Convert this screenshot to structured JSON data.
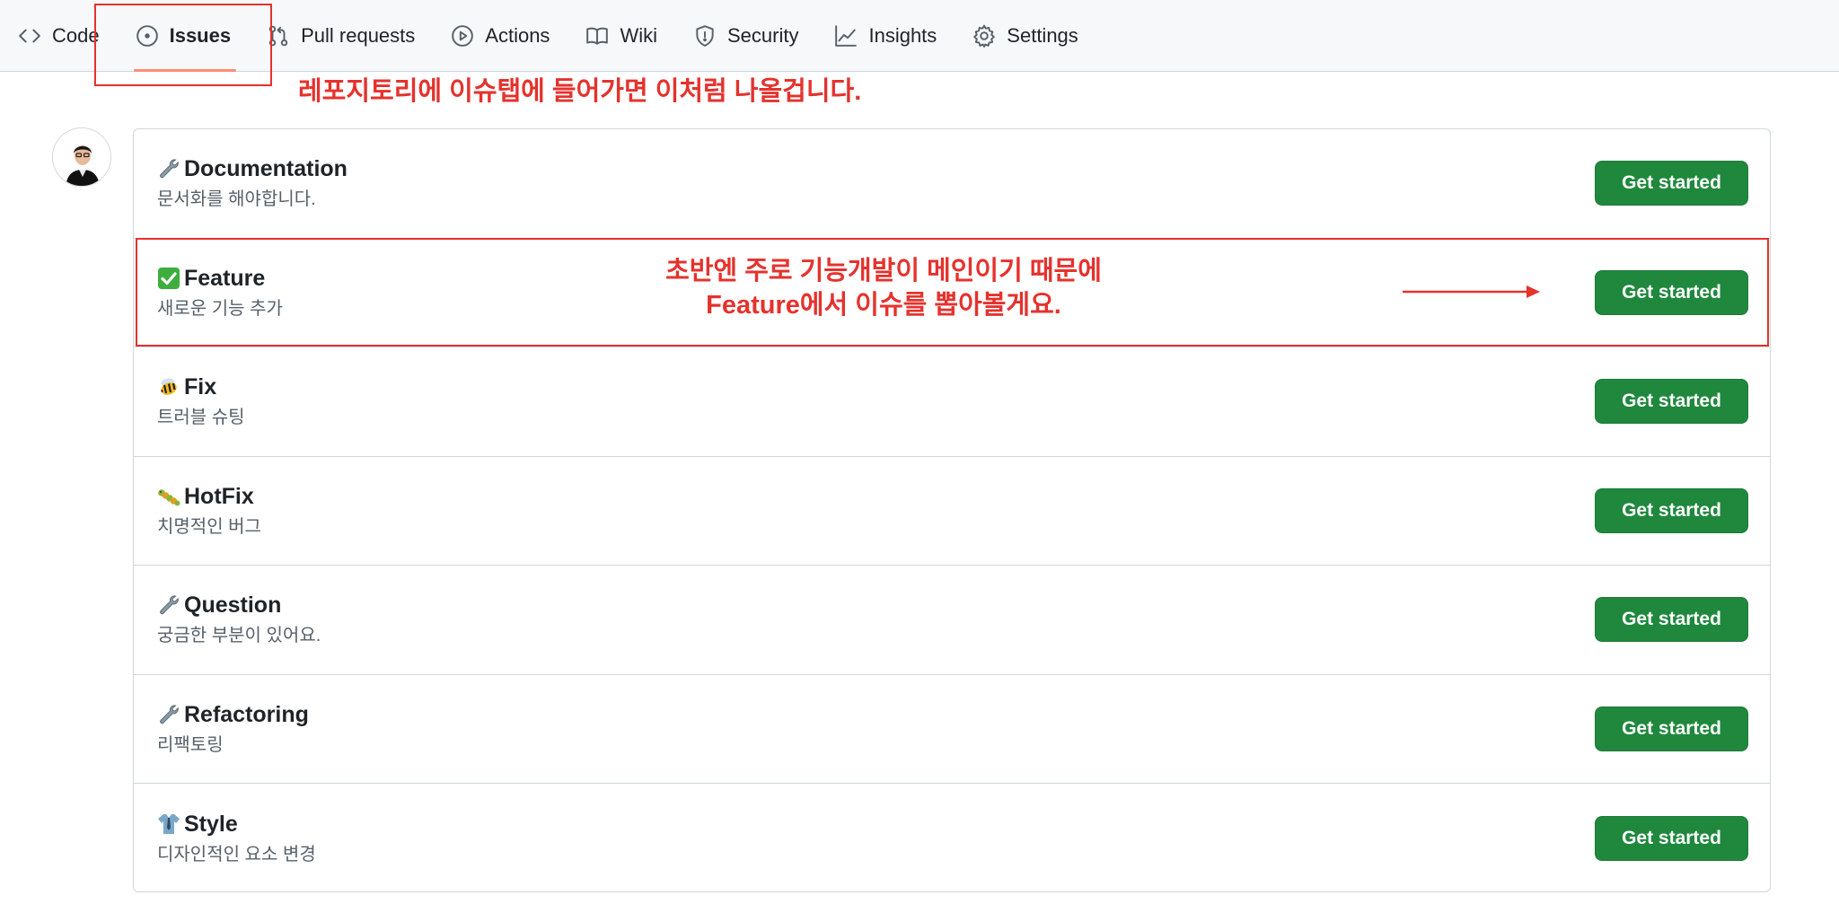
{
  "nav": {
    "items": [
      {
        "label": "Code",
        "icon": "code-icon"
      },
      {
        "label": "Issues",
        "icon": "issue-opened-icon",
        "selected": true
      },
      {
        "label": "Pull requests",
        "icon": "git-pull-request-icon"
      },
      {
        "label": "Actions",
        "icon": "play-icon"
      },
      {
        "label": "Wiki",
        "icon": "book-icon"
      },
      {
        "label": "Security",
        "icon": "shield-icon"
      },
      {
        "label": "Insights",
        "icon": "graph-icon"
      },
      {
        "label": "Settings",
        "icon": "gear-icon"
      }
    ]
  },
  "annotations": {
    "tab_note": "레포지토리에 이슈탭에 들어가면 이처럼 나올겁니다.",
    "feature_note_line1": "초반엔 주로 기능개발이 메인이기 때문에",
    "feature_note_line2": "Feature에서 이슈를 뽑아볼게요.",
    "color": "#e5322d"
  },
  "templates": [
    {
      "title": "Documentation",
      "description": "문서화를 해야합니다.",
      "emoji": "wrench-icon",
      "button": "Get started"
    },
    {
      "title": "Feature",
      "description": "새로운 기능 추가",
      "emoji": "check-mark-icon",
      "button": "Get started"
    },
    {
      "title": "Fix",
      "description": "트러블 슈팅",
      "emoji": "bee-icon",
      "button": "Get started"
    },
    {
      "title": "HotFix",
      "description": "치명적인 버그",
      "emoji": "caterpillar-icon",
      "button": "Get started"
    },
    {
      "title": "Question",
      "description": "궁금한 부분이 있어요.",
      "emoji": "wrench-icon",
      "button": "Get started"
    },
    {
      "title": "Refactoring",
      "description": "리팩토링",
      "emoji": "wrench-icon",
      "button": "Get started"
    },
    {
      "title": "Style",
      "description": "디자인적인 요소 변경",
      "emoji": "shirt-tie-icon",
      "button": "Get started"
    }
  ],
  "colors": {
    "button_green": "#1f883d",
    "selected_underline": "#fd8c73",
    "border": "#d0d7de"
  }
}
